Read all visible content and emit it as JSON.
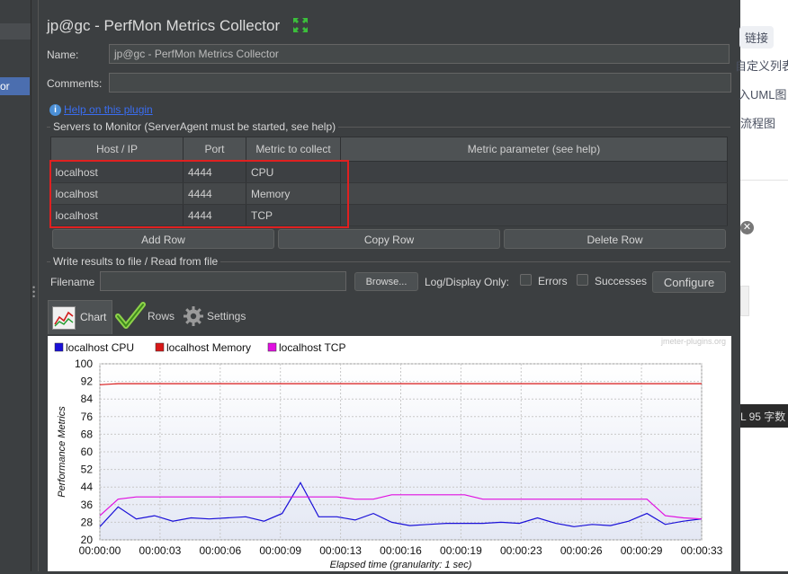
{
  "sidebar": {
    "selected_label": "or"
  },
  "header": {
    "title": "jp@gc - PerfMon Metrics Collector",
    "expand_icon": "expand-arrows-icon"
  },
  "form": {
    "name_label": "Name:",
    "name_value": "jp@gc - PerfMon Metrics Collector",
    "comments_label": "Comments:",
    "comments_value": "",
    "help_link": "Help on this plugin"
  },
  "servers": {
    "section_title": "Servers to Monitor (ServerAgent must be started, see help)",
    "columns": [
      "Host / IP",
      "Port",
      "Metric to collect",
      "Metric parameter (see help)"
    ],
    "rows": [
      {
        "host": "localhost",
        "port": "4444",
        "metric": "CPU",
        "param": ""
      },
      {
        "host": "localhost",
        "port": "4444",
        "metric": "Memory",
        "param": ""
      },
      {
        "host": "localhost",
        "port": "4444",
        "metric": "TCP",
        "param": ""
      }
    ],
    "highlight_color": "#e02020",
    "add_row": "Add Row",
    "copy_row": "Copy Row",
    "delete_row": "Delete Row"
  },
  "file": {
    "section_title": "Write results to file / Read from file",
    "filename_label": "Filename",
    "filename_value": "",
    "browse": "Browse...",
    "log_display_label": "Log/Display Only:",
    "errors_label": "Errors",
    "successes_label": "Successes",
    "configure": "Configure"
  },
  "tabs": [
    {
      "label": "Chart",
      "icon": "chart-icon"
    },
    {
      "label": "Rows",
      "icon": "checkmark-icon"
    },
    {
      "label": "Settings",
      "icon": "gear-icon"
    }
  ],
  "chart_data": {
    "type": "line",
    "watermark": "jmeter-plugins.org",
    "ylabel": "Performance Metrics",
    "xlabel": "Elapsed time (granularity: 1 sec)",
    "ylim": [
      20,
      100
    ],
    "yticks": [
      20,
      28,
      36,
      44,
      52,
      60,
      68,
      76,
      84,
      92,
      100
    ],
    "xlim": [
      0,
      33
    ],
    "xticks": [
      "00:00:00",
      "00:00:03",
      "00:00:06",
      "00:00:09",
      "00:00:13",
      "00:00:16",
      "00:00:19",
      "00:00:23",
      "00:00:26",
      "00:00:29",
      "00:00:33"
    ],
    "grid": true,
    "legend": "top-left",
    "series": [
      {
        "name": "localhost CPU",
        "color": "#1a10d8",
        "x": [
          0,
          1,
          2,
          3,
          4,
          5,
          6,
          7,
          8,
          9,
          10,
          11,
          12,
          13,
          14,
          15,
          16,
          17,
          18,
          19,
          20,
          21,
          22,
          23,
          24,
          25,
          26,
          27,
          28,
          29,
          30,
          31,
          32,
          33
        ],
        "y": [
          26,
          35,
          29.5,
          31,
          28.5,
          30,
          29.5,
          30,
          30.5,
          28.5,
          32,
          46,
          30.5,
          30.5,
          29,
          32,
          28,
          26.5,
          27,
          27.5,
          27.5,
          27.5,
          28,
          27.5,
          30,
          27.5,
          26,
          27,
          26.5,
          28.5,
          32,
          27,
          28.5,
          29.5
        ]
      },
      {
        "name": "localhost Memory",
        "color": "#d81818",
        "x": [
          0,
          1,
          33
        ],
        "y": [
          90.5,
          91,
          91
        ]
      },
      {
        "name": "localhost TCP",
        "color": "#e010e0",
        "x": [
          0,
          1,
          2,
          3,
          4,
          5,
          6,
          7,
          8,
          9,
          10,
          11,
          12,
          13,
          14,
          15,
          16,
          17,
          18,
          19,
          20,
          21,
          22,
          23,
          24,
          25,
          26,
          27,
          28,
          29,
          30,
          31,
          32,
          33
        ],
        "y": [
          31,
          38.5,
          39.5,
          39.5,
          39.5,
          39.5,
          39.5,
          39.5,
          39.5,
          39.5,
          39.5,
          39.5,
          39.5,
          39.5,
          38.5,
          38.5,
          40.5,
          40.5,
          40.5,
          40.5,
          40.5,
          38.5,
          38.5,
          38.5,
          38.5,
          38.5,
          38.5,
          38.5,
          38.5,
          38.5,
          38.5,
          31,
          30,
          29.5
        ]
      }
    ]
  },
  "right_panel": {
    "chips": [
      "链接",
      "自定义列表",
      "入UML图",
      "流程图"
    ],
    "status_text": "L 95 字数",
    "close_icon": "close-circle-icon"
  }
}
